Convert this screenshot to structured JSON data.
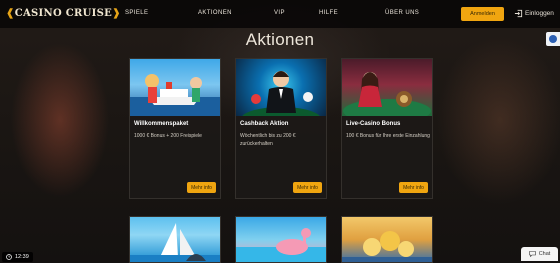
{
  "logo": {
    "text": "CASINO CRUISE"
  },
  "nav": {
    "items": [
      "SPIELE",
      "AKTIONEN",
      "VIP",
      "HILFE",
      "ÜBER UNS"
    ]
  },
  "header": {
    "register_label": "Anmelden",
    "login_label": "Einloggen"
  },
  "page": {
    "title": "Aktionen"
  },
  "cards": [
    {
      "title": "Willkommenspaket",
      "desc": "1000 € Bonus + 200 Freispiele",
      "button": "Mehr info"
    },
    {
      "title": "Cashback Aktion",
      "desc": "Wöchentlich bis zu 200 € zurückerhalten",
      "button": "Mehr info"
    },
    {
      "title": "Live-Casino Bonus",
      "desc": "100 € Bonus für Ihre erste Einzahlung",
      "button": "Mehr info"
    }
  ],
  "status": {
    "time": "12:39",
    "chat_label": "Chat"
  },
  "colors": {
    "accent": "#f0a510",
    "background": "#161310",
    "card": "#1c1917"
  },
  "icons": [
    "login-icon",
    "clock-icon",
    "chat-icon",
    "side-widget-icon"
  ]
}
